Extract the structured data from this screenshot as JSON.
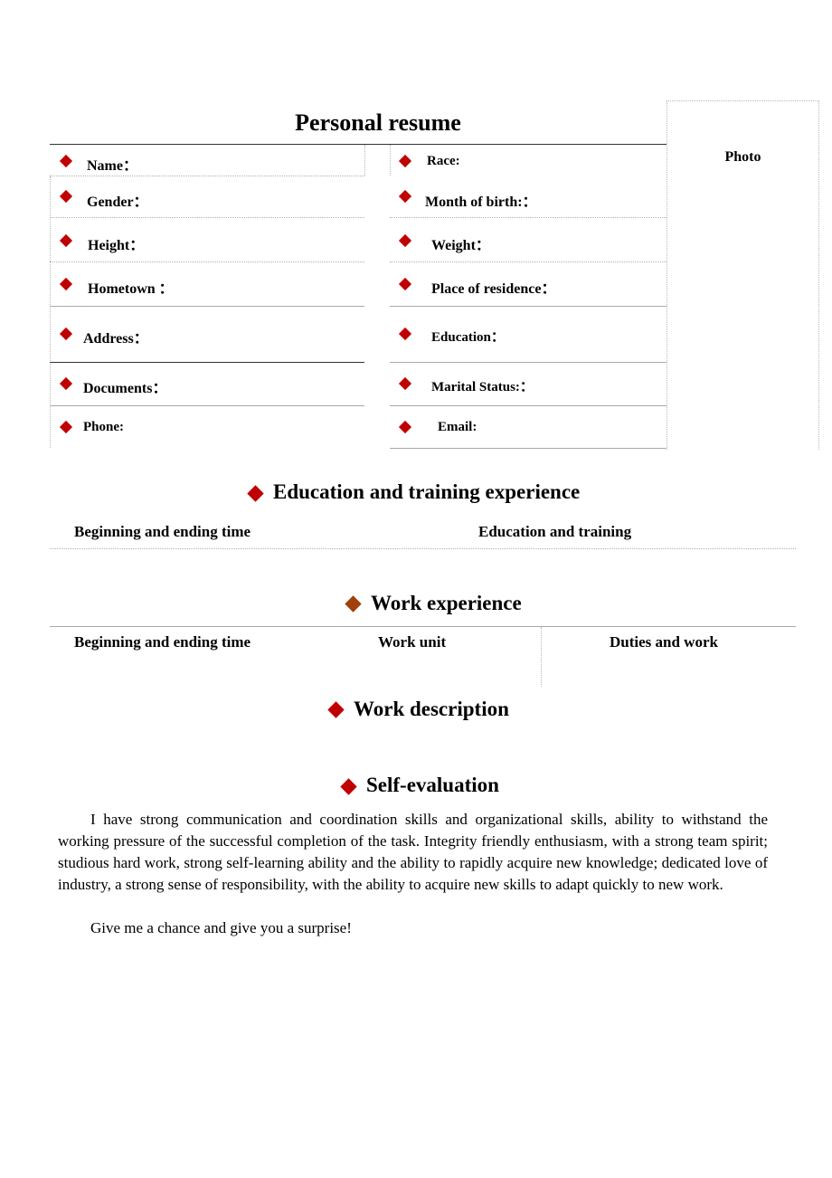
{
  "title": "Personal resume",
  "photo_label": "Photo",
  "personal_info": {
    "left": [
      "Name：",
      "Gender：",
      "Height：",
      "Hometown ：",
      "Address：",
      "Documents：",
      "Phone:"
    ],
    "right": [
      "Race:",
      "Month of birth:：",
      "Weight：",
      "Place of residence：",
      "Education：",
      "Marital Status:：",
      "Email:"
    ]
  },
  "education": {
    "title": "Education and training experience",
    "columns": [
      "Beginning and ending time",
      "Education and training"
    ]
  },
  "work": {
    "title": "Work experience",
    "columns": [
      "Beginning and ending time",
      "Work unit",
      "Duties and work"
    ]
  },
  "work_description": {
    "title": "Work description"
  },
  "self_evaluation": {
    "title": "Self-evaluation",
    "paragraphs": [
      "I have strong communication and coordination skills and organizational skills, ability to withstand the working pressure of the successful completion of the task. Integrity friendly enthusiasm, with a strong team spirit; studious hard work, strong self-learning ability and the ability to rapidly acquire new knowledge; dedicated love of industry, a strong sense of responsibility, with the ability to acquire new skills to adapt quickly to new work.",
      "Give me a chance and give you a surprise!"
    ]
  },
  "colors": {
    "bullet": "#c00000",
    "bullet_work": "#a0400a"
  }
}
